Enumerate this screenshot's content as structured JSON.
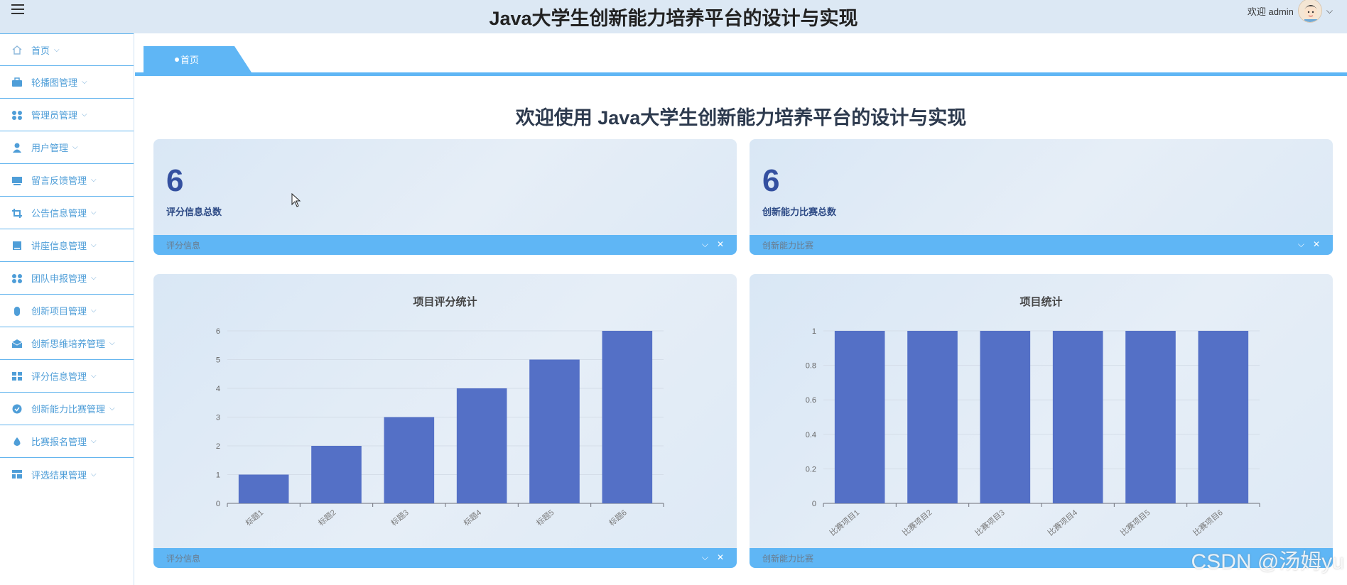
{
  "header": {
    "title": "Java大学生创新能力培养平台的设计与实现",
    "welcome_user": "欢迎 admin"
  },
  "sidebar": {
    "items": [
      {
        "label": "首页",
        "icon": "home-icon"
      },
      {
        "label": "轮播图管理",
        "icon": "briefcase-icon"
      },
      {
        "label": "管理员管理",
        "icon": "grid-icon"
      },
      {
        "label": "用户管理",
        "icon": "user-icon"
      },
      {
        "label": "留言反馈管理",
        "icon": "monitor-icon"
      },
      {
        "label": "公告信息管理",
        "icon": "crop-icon"
      },
      {
        "label": "讲座信息管理",
        "icon": "tablet-icon"
      },
      {
        "label": "团队申报管理",
        "icon": "grid-icon"
      },
      {
        "label": "创新项目管理",
        "icon": "mouse-icon"
      },
      {
        "label": "创新思维培养管理",
        "icon": "mail-icon"
      },
      {
        "label": "评分信息管理",
        "icon": "apps-icon"
      },
      {
        "label": "创新能力比赛管理",
        "icon": "check-circle-icon"
      },
      {
        "label": "比赛报名管理",
        "icon": "drop-icon"
      },
      {
        "label": "评选结果管理",
        "icon": "layout-icon"
      }
    ]
  },
  "tabs": [
    {
      "label": "首页"
    }
  ],
  "main": {
    "welcome": "欢迎使用 Java大学生创新能力培养平台的设计与实现",
    "stats": [
      {
        "value": "6",
        "label": "评分信息总数",
        "footer": "评分信息"
      },
      {
        "value": "6",
        "label": "创新能力比赛总数",
        "footer": "创新能力比赛"
      }
    ],
    "chart_footers": [
      "评分信息",
      "创新能力比赛"
    ]
  },
  "colors": {
    "bar": "#5470c6",
    "accent": "#5fb6f5",
    "sidebar_text": "#4f9ed8"
  },
  "chart_data": [
    {
      "type": "bar",
      "title": "项目评分统计",
      "categories": [
        "标题1",
        "标题2",
        "标题3",
        "标题4",
        "标题5",
        "标题6"
      ],
      "values": [
        1,
        2,
        3,
        4,
        5,
        6
      ],
      "yticks": [
        "0",
        "1",
        "2",
        "3",
        "4",
        "5",
        "6"
      ],
      "ylim": [
        0,
        6
      ]
    },
    {
      "type": "bar",
      "title": "项目统计",
      "categories": [
        "比赛项目1",
        "比赛项目2",
        "比赛项目3",
        "比赛项目4",
        "比赛项目5",
        "比赛项目6"
      ],
      "values": [
        1,
        1,
        1,
        1,
        1,
        1
      ],
      "yticks": [
        "0",
        "0.2",
        "0.4",
        "0.6",
        "0.8",
        "1"
      ],
      "ylim": [
        0,
        1
      ]
    }
  ],
  "watermark": "CSDN @汤姆yu"
}
